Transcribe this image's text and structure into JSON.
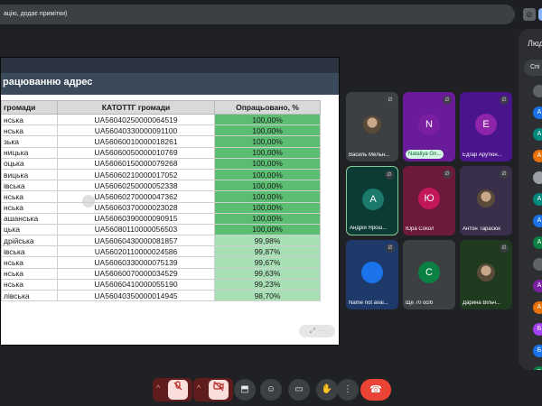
{
  "notice": {
    "text": "ацію, додає примітки)"
  },
  "slide": {
    "title": "рацюванню адрес",
    "headers": [
      "громади",
      "КАТОТТГ громади",
      "Опрацьовано, %"
    ],
    "rows": [
      [
        "нська",
        "UA56040250000064519",
        "100,00%"
      ],
      [
        "нська",
        "UA56040330000091100",
        "100,00%"
      ],
      [
        "зька",
        "UA56060010000018261",
        "100,00%"
      ],
      [
        "ницька",
        "UA56060050000010769",
        "100,00%"
      ],
      [
        "оцька",
        "UA56060150000079268",
        "100,00%"
      ],
      [
        "вицька",
        "UA56060210000017052",
        "100,00%"
      ],
      [
        "івська",
        "UA56060250000052338",
        "100,00%"
      ],
      [
        "нська",
        "UA56060270000047362",
        "100,00%"
      ],
      [
        "нська",
        "UA56060370000023028",
        "100,00%"
      ],
      [
        "ашанська",
        "UA56060390000090915",
        "100,00%"
      ],
      [
        "цька",
        "UA56080110000056503",
        "100,00%"
      ],
      [
        "дрійська",
        "UA56060430000081857",
        "99,98%"
      ],
      [
        "івська",
        "UA56020110000024586",
        "99,87%"
      ],
      [
        "нська",
        "UA56060330000075139",
        "99,67%"
      ],
      [
        "нська",
        "UA56060070000034529",
        "99,63%"
      ],
      [
        "нська",
        "UA56060410000055190",
        "99,23%"
      ],
      [
        "лівська",
        "UA56040350000014945",
        "98,70%"
      ]
    ],
    "colors": {
      "full": "#5bbd72",
      "partial": "#a8e0b5"
    }
  },
  "tiles": [
    {
      "name": "Василь Мельн...",
      "avatar": "",
      "color": "#3c4043",
      "kind": "photo"
    },
    {
      "name": "Nataliya Gn...",
      "avatar": "N",
      "color": "#7b1fa2",
      "kind": "letter",
      "bg": "#6a1b9a"
    },
    {
      "name": "Едгар Арутюн...",
      "avatar": "E",
      "color": "#8e24aa",
      "kind": "letter",
      "bg": "#4a148c"
    },
    {
      "name": "Андрій Ярош...",
      "avatar": "A",
      "color": "#1b7a6b",
      "kind": "letter",
      "bg": "#0b3b34"
    },
    {
      "name": "Юра Сокол",
      "avatar": "Ю",
      "color": "#c2185b",
      "kind": "letter",
      "bg": "#6d1a3a"
    },
    {
      "name": "Антон Тарасюк",
      "avatar": "",
      "color": "#3c4043",
      "kind": "photo",
      "bg": "#3a2f4a"
    },
    {
      "name": "Name not avai...",
      "avatar": "",
      "color": "#1a73e8",
      "kind": "letter",
      "bg": "#1e3a6a"
    },
    {
      "name": "Ще 70 осіб",
      "avatar": "C",
      "color": "#0b8043",
      "kind": "letter",
      "bg": "#3c4043"
    },
    {
      "name": "Дарина Вільч...",
      "avatar": "",
      "color": "#3c4043",
      "kind": "photo",
      "bg": "#1f3a1f"
    }
  ],
  "panel": {
    "title": "Люд",
    "tab": "Спі",
    "avatars": [
      {
        "letter": "",
        "color": "#5f6368"
      },
      {
        "letter": "A",
        "color": "#1a73e8"
      },
      {
        "letter": "A",
        "color": "#00897b"
      },
      {
        "letter": "A",
        "color": "#e8710a"
      },
      {
        "letter": "",
        "color": "#9aa0a6"
      },
      {
        "letter": "A",
        "color": "#00897b"
      },
      {
        "letter": "A",
        "color": "#1a73e8"
      },
      {
        "letter": "A",
        "color": "#0b8043"
      },
      {
        "letter": "",
        "color": "#5f6368"
      },
      {
        "letter": "A",
        "color": "#7b1fa2"
      },
      {
        "letter": "A",
        "color": "#e8710a"
      },
      {
        "letter": "Б",
        "color": "#a142f4"
      },
      {
        "letter": "Б",
        "color": "#1a73e8"
      },
      {
        "letter": "В",
        "color": "#0b8043"
      },
      {
        "letter": "",
        "color": "#9aa0a6"
      }
    ]
  },
  "controls": {
    "chevron": "^",
    "mic_icon": "mic-off",
    "camera_icon": "camera-off",
    "present_icon": "present",
    "emoji_icon": "emoji",
    "captions_icon": "captions",
    "hand_icon": "raise-hand",
    "more_icon": "more",
    "end_icon": "end-call"
  }
}
